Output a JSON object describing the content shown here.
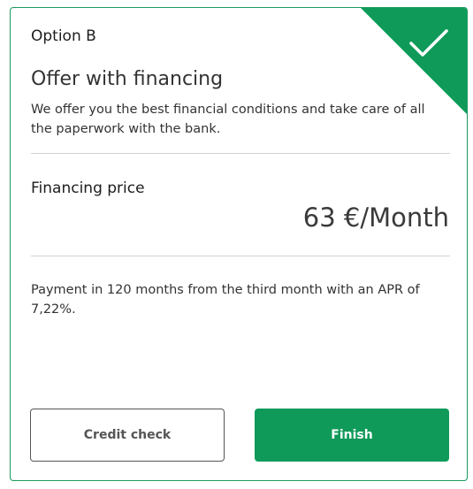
{
  "card": {
    "option_label": "Option B",
    "title": "Offer with financing",
    "description": "We offer you the best financial conditions and take care of all the paperwork with the bank.",
    "selected_icon": "checkmark-icon",
    "accent_color": "#0f9a5a"
  },
  "financing": {
    "label": "Financing price",
    "price": "63 €/Month"
  },
  "payment_note": "Payment in 120 months from the third month with an APR of 7,22%.",
  "actions": {
    "secondary_label": "Credit check",
    "primary_label": "Finish"
  }
}
